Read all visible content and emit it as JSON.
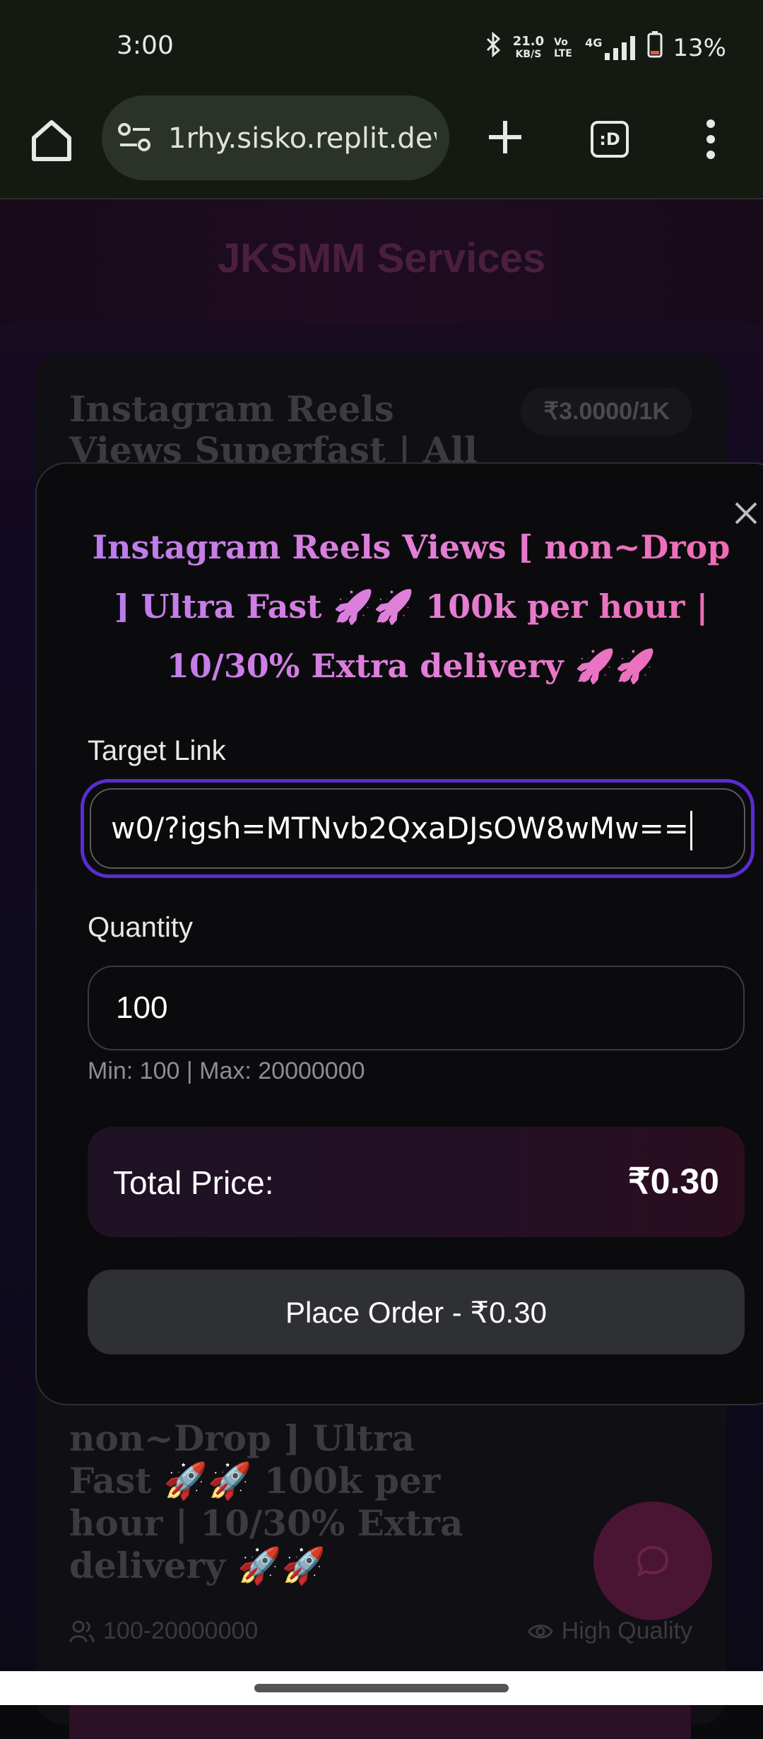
{
  "status_bar": {
    "time": "3:00",
    "net_speed_value": "21.0",
    "net_speed_unit": "KB/S",
    "volte": "Vo LTE",
    "network": "4G",
    "battery": "13%"
  },
  "browser": {
    "url": "1rhy.sisko.replit.dev",
    "tabs_label": ":D"
  },
  "page": {
    "title": "JKSMM Services",
    "card_title": "Instagram Reels Views Superfast | All Link | Day",
    "card_price": "₹3.0000/1K",
    "card_desc": "non~Drop ] Ultra Fast 🚀🚀 100k per hour | 10/30% Extra delivery 🚀🚀",
    "card_range": "100-20000000",
    "card_quality": "High Quality"
  },
  "modal": {
    "title": "Instagram Reels Views [ non~Drop ] Ultra Fast 🚀🚀 100k per hour | 10/30% Extra delivery 🚀🚀",
    "target_link_label": "Target Link",
    "target_link_value": "w0/?igsh=MTNvb2QxaDJsOW8wMw==",
    "quantity_label": "Quantity",
    "quantity_value": "100",
    "min_max": "Min: 100 | Max: 20000000",
    "total_label": "Total Price:",
    "total_value": "₹0.30",
    "order_button": "Place Order - ₹0.30"
  },
  "colors": {
    "accent_focus": "#5b2bd1",
    "title_gradient_start": "#b77cf0",
    "title_gradient_end": "#f06bb1"
  }
}
